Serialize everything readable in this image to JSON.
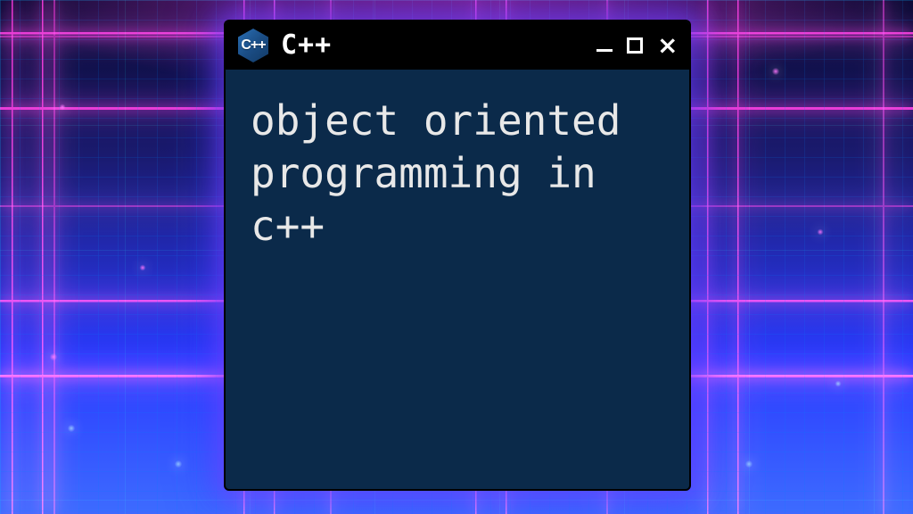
{
  "window": {
    "title": "C++",
    "logo_text": "C++",
    "controls": {
      "minimize": "minimize",
      "maximize": "maximize",
      "close": "×"
    }
  },
  "content": {
    "text": "object oriented programming in c++"
  }
}
